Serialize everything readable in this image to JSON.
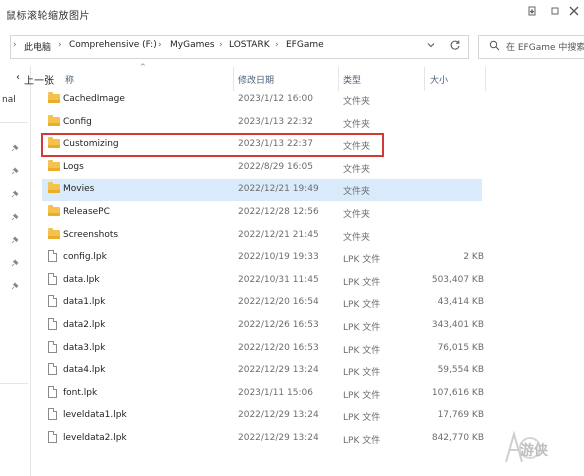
{
  "window": {
    "title": "鼠标滚轮缩放图片",
    "minimize_icon": "minimize-icon",
    "maximize_icon": "maximize-icon",
    "close_icon": "close-icon"
  },
  "address_bar": {
    "breadcrumbs": [
      "此电脑",
      "Comprehensive (F:)",
      "MyGames",
      "LOSTARK",
      "EFGame"
    ],
    "separator": "›",
    "dropdown_icon": "chevron-down-icon",
    "refresh_icon": "refresh-icon"
  },
  "search": {
    "placeholder": "在 EFGame 中搜索",
    "icon": "search-icon"
  },
  "nav": {
    "back_label": "上一张",
    "partial_text": "nal"
  },
  "columns": {
    "name": "名称",
    "name_visible": "称",
    "date": "修改日期",
    "type": "类型",
    "size": "大小"
  },
  "files": [
    {
      "name": "CachedImage",
      "date": "2023/1/12 16:00",
      "type": "文件夹",
      "size": "",
      "kind": "folder"
    },
    {
      "name": "Config",
      "date": "2023/1/13 22:32",
      "type": "文件夹",
      "size": "",
      "kind": "folder"
    },
    {
      "name": "Customizing",
      "date": "2023/1/13 22:37",
      "type": "文件夹",
      "size": "",
      "kind": "folder",
      "highlighted": true
    },
    {
      "name": "Logs",
      "date": "2022/8/29 16:05",
      "type": "文件夹",
      "size": "",
      "kind": "folder"
    },
    {
      "name": "Movies",
      "date": "2022/12/21 19:49",
      "type": "文件夹",
      "size": "",
      "kind": "folder",
      "hover": true
    },
    {
      "name": "ReleasePC",
      "date": "2022/12/28 12:56",
      "type": "文件夹",
      "size": "",
      "kind": "folder"
    },
    {
      "name": "Screenshots",
      "date": "2022/12/21 21:45",
      "type": "文件夹",
      "size": "",
      "kind": "folder"
    },
    {
      "name": "config.lpk",
      "date": "2022/10/19 19:33",
      "type": "LPK 文件",
      "size": "2 KB",
      "kind": "file"
    },
    {
      "name": "data.lpk",
      "date": "2022/10/31 11:45",
      "type": "LPK 文件",
      "size": "503,407 KB",
      "kind": "file"
    },
    {
      "name": "data1.lpk",
      "date": "2022/12/20 16:54",
      "type": "LPK 文件",
      "size": "43,414 KB",
      "kind": "file"
    },
    {
      "name": "data2.lpk",
      "date": "2022/12/26 16:53",
      "type": "LPK 文件",
      "size": "343,401 KB",
      "kind": "file"
    },
    {
      "name": "data3.lpk",
      "date": "2022/12/20 16:53",
      "type": "LPK 文件",
      "size": "76,015 KB",
      "kind": "file"
    },
    {
      "name": "data4.lpk",
      "date": "2022/12/29 13:24",
      "type": "LPK 文件",
      "size": "59,554 KB",
      "kind": "file"
    },
    {
      "name": "font.lpk",
      "date": "2023/1/11 15:06",
      "type": "LPK 文件",
      "size": "107,616 KB",
      "kind": "file"
    },
    {
      "name": "leveldata1.lpk",
      "date": "2022/12/29 13:24",
      "type": "LPK 文件",
      "size": "17,769 KB",
      "kind": "file"
    },
    {
      "name": "leveldata2.lpk",
      "date": "2022/12/29 13:24",
      "type": "LPK 文件",
      "size": "842,770 KB",
      "kind": "file"
    }
  ],
  "watermark": {
    "text": "游侠"
  },
  "colors": {
    "hover_row": "#d9ebfa",
    "highlight_outline": "#d23a3a",
    "folder": "#f5c24d",
    "header_text": "#4c607a"
  }
}
